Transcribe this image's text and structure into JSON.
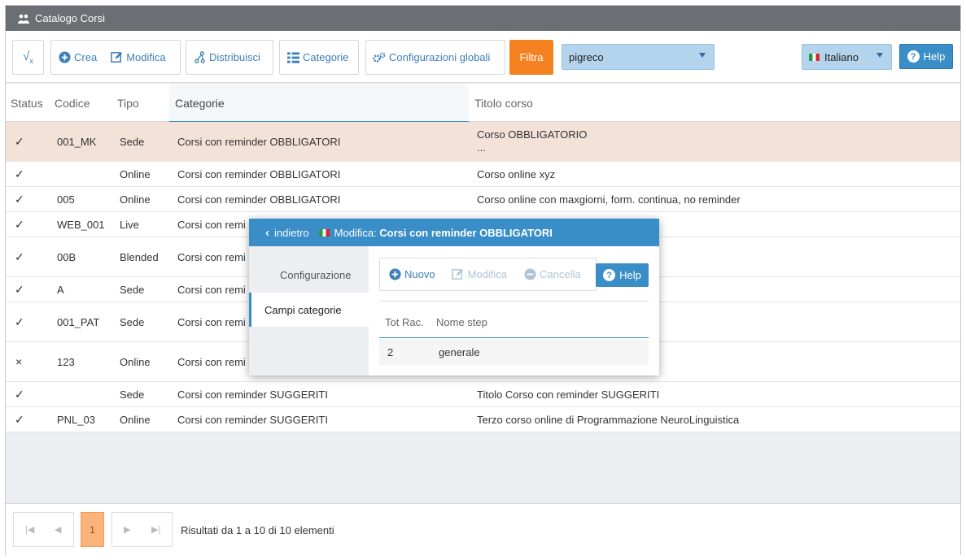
{
  "window": {
    "title": "Catalogo Corsi"
  },
  "toolbar": {
    "crea": "Crea",
    "modifica": "Modifica",
    "distribuisci": "Distribuisci",
    "categorie": "Categorie",
    "configurazioni": "Configurazioni globali",
    "filtra": "Filtra",
    "filter_value": "pigreco",
    "language": "Italiano",
    "help": "Help"
  },
  "grid": {
    "columns": [
      "Status",
      "Codice",
      "Tipo",
      "Categorie",
      "Titolo corso"
    ],
    "rows": [
      {
        "status": "✓",
        "codice": "001_MK",
        "tipo": "Sede",
        "categoria": "Corsi con reminder OBBLIGATORI",
        "titolo": "Corso OBBLIGATORIO",
        "titolo2": "..."
      },
      {
        "status": "✓",
        "codice": "",
        "tipo": "Online",
        "categoria": "Corsi con reminder OBBLIGATORI",
        "titolo": "Corso online xyz"
      },
      {
        "status": "✓",
        "codice": "005",
        "tipo": "Online",
        "categoria": "Corsi con reminder OBBLIGATORI",
        "titolo": "Corso online con maxgiorni, form. continua, no reminder"
      },
      {
        "status": "✓",
        "codice": "WEB_001",
        "tipo": "Live",
        "categoria": "Corsi con remi",
        "titolo": ""
      },
      {
        "status": "✓",
        "codice": "00B",
        "tipo": "Blended",
        "categoria": "Corsi con remi",
        "titolo": ""
      },
      {
        "status": "✓",
        "codice": "A",
        "tipo": "Sede",
        "categoria": "Corsi con remi",
        "titolo": ""
      },
      {
        "status": "✓",
        "codice": "001_PAT",
        "tipo": "Sede",
        "categoria": "Corsi con remi",
        "titolo": ""
      },
      {
        "status": "×",
        "codice": "123",
        "tipo": "Online",
        "categoria": "Corsi con remi",
        "titolo": ""
      },
      {
        "status": "✓",
        "codice": "",
        "tipo": "Sede",
        "categoria": "Corsi con reminder SUGGERITI",
        "titolo": "Titolo Corso con reminder SUGGERITI"
      },
      {
        "status": "✓",
        "codice": "PNL_03",
        "tipo": "Online",
        "categoria": "Corsi con reminder SUGGERITI",
        "titolo": "Terzo corso online di Programmazione NeuroLinguistica"
      }
    ]
  },
  "pager": {
    "current_page": "1",
    "summary": "Risultati da 1 a 10 di 10 elementi"
  },
  "dialog": {
    "back": "indietro",
    "title_prefix": "Modifica:",
    "title_name": "Corsi con reminder OBBLIGATORI",
    "tabs": [
      "Configurazione",
      "Campi categorie"
    ],
    "tools": {
      "nuovo": "Nuovo",
      "modifica": "Modifica",
      "cancella": "Cancella",
      "help": "Help"
    },
    "columns": [
      "Tot Rac.",
      "Nome step"
    ],
    "rows": [
      {
        "tot": "2",
        "nome": "generale"
      }
    ]
  },
  "colors": {
    "accent": "#3a8ec8",
    "filter": "#f58220",
    "selected_row": "#f3e2d8"
  }
}
